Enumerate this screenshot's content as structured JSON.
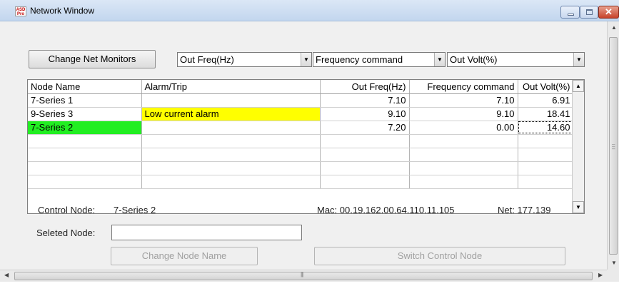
{
  "window": {
    "title": "Network Window",
    "app_icon_text": "ASD Pro"
  },
  "toolbar": {
    "change_monitors_label": "Change Net Monitors",
    "monitors": [
      {
        "value": "Out Freq(Hz)"
      },
      {
        "value": "Frequency command"
      },
      {
        "value": "Out Volt(%)"
      }
    ]
  },
  "table": {
    "columns": [
      "Node Name",
      "Alarm/Trip",
      "Out Freq(Hz)",
      "Frequency command",
      "Out Volt(%)"
    ],
    "rows": [
      {
        "node": "7-Series 1",
        "alarm": "",
        "out_freq": "7.10",
        "freq_cmd": "7.10",
        "out_volt": "6.91"
      },
      {
        "node": "9-Series 3",
        "alarm": "Low current alarm",
        "out_freq": "9.10",
        "freq_cmd": "9.10",
        "out_volt": "18.41"
      },
      {
        "node": "7-Series 2",
        "alarm": "",
        "out_freq": "7.20",
        "freq_cmd": "0.00",
        "out_volt": "14.60"
      }
    ],
    "empty_rows": 4,
    "alarm_color": "#ffff00",
    "control_node_color": "#22ee22"
  },
  "status": {
    "control_node_label": "Control Node:",
    "control_node_value": "7-Series 2",
    "mac": "Mac: 00.19.162.00.64.110.11.105",
    "net": "Net: 177.139"
  },
  "selected": {
    "label": "Seleted Node:",
    "value": ""
  },
  "actions": {
    "change_node_name": "Change Node Name",
    "switch_control_node": "Switch Control Node"
  },
  "icons": {
    "scroll_up": "up-arrow-icon",
    "scroll_down": "down-arrow-icon",
    "scroll_left": "left-arrow-icon",
    "scroll_right": "right-arrow-icon",
    "dropdown": "chevron-down-icon"
  }
}
